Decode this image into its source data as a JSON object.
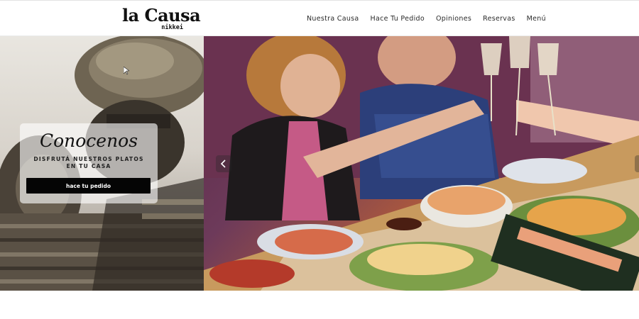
{
  "header": {
    "logo": {
      "main": "la Causa",
      "sub": "nikkei"
    },
    "nav": [
      {
        "label": "Nuestra Causa"
      },
      {
        "label": "Hace Tu Pedido"
      },
      {
        "label": "Opiniones"
      },
      {
        "label": "Reservas"
      },
      {
        "label": "Menú"
      }
    ]
  },
  "hero": {
    "card": {
      "title": "Conocenos",
      "subtitle_line1": "DISFRUTÁ NUESTROS PLATOS",
      "subtitle_line2": "EN TU CASA",
      "button_label": "hace tu pedido"
    },
    "slider": {
      "prev_icon": "chevron-left-icon",
      "next_icon": "chevron-right-icon"
    }
  },
  "colors": {
    "header_bg": "#ffffff",
    "nav_text": "#2a2a2a",
    "button_bg": "#050505",
    "button_text": "#ffffff"
  }
}
